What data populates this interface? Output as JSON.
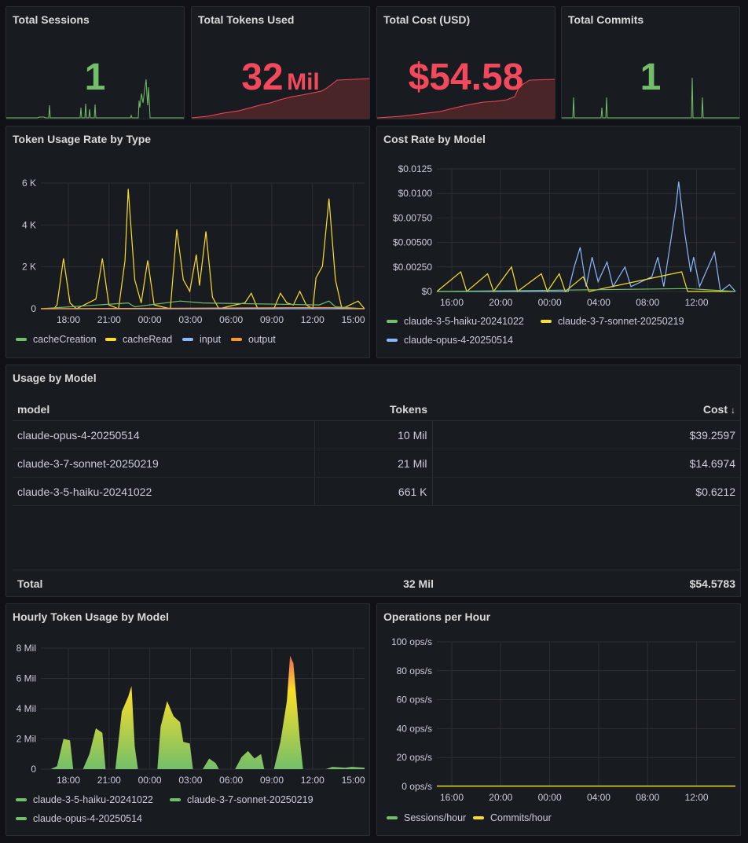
{
  "stats": {
    "sessions": {
      "title": "Total Sessions",
      "value": "1",
      "color": "#73bf69"
    },
    "tokens": {
      "title": "Total Tokens Used",
      "value": "32",
      "unit": "Mil",
      "color": "#f2495c"
    },
    "cost": {
      "title": "Total Cost (USD)",
      "value": "$54.58",
      "color": "#f2495c"
    },
    "commits": {
      "title": "Total Commits",
      "value": "1",
      "color": "#73bf69"
    }
  },
  "token_rate": {
    "title": "Token Usage Rate by Type",
    "legend": [
      {
        "name": "cacheCreation",
        "color": "#73bf69"
      },
      {
        "name": "cacheRead",
        "color": "#fade2a"
      },
      {
        "name": "input",
        "color": "#8ab8ff"
      },
      {
        "name": "output",
        "color": "#ff9830"
      }
    ]
  },
  "cost_rate": {
    "title": "Cost Rate by Model",
    "legend": [
      {
        "name": "claude-3-5-haiku-20241022",
        "color": "#73bf69"
      },
      {
        "name": "claude-3-7-sonnet-20250219",
        "color": "#fade2a"
      },
      {
        "name": "claude-opus-4-20250514",
        "color": "#8ab8ff"
      }
    ]
  },
  "usage_table": {
    "title": "Usage by Model",
    "columns": {
      "model": "model",
      "tokens": "Tokens",
      "cost": "Cost"
    },
    "sort_icon": "arrow-down-icon",
    "rows": [
      {
        "model": "claude-opus-4-20250514",
        "tokens": "10 Mil",
        "cost": "$39.2597"
      },
      {
        "model": "claude-3-7-sonnet-20250219",
        "tokens": "21 Mil",
        "cost": "$14.6974"
      },
      {
        "model": "claude-3-5-haiku-20241022",
        "tokens": "661 K",
        "cost": "$0.6212"
      }
    ],
    "total": {
      "label": "Total",
      "tokens": "32 Mil",
      "cost": "$54.5783"
    }
  },
  "hourly": {
    "title": "Hourly Token Usage by Model",
    "legend": [
      {
        "name": "claude-3-5-haiku-20241022",
        "color": "#73bf69"
      },
      {
        "name": "claude-3-7-sonnet-20250219",
        "color": "#73bf69"
      },
      {
        "name": "claude-opus-4-20250514",
        "color": "#73bf69"
      }
    ]
  },
  "ops": {
    "title": "Operations per Hour",
    "legend": [
      {
        "name": "Sessions/hour",
        "color": "#73bf69"
      },
      {
        "name": "Commits/hour",
        "color": "#fade2a"
      }
    ]
  },
  "chart_data": [
    {
      "type": "line",
      "title": "Token Usage Rate by Type",
      "x_ticks": [
        "18:00",
        "21:00",
        "00:00",
        "03:00",
        "06:00",
        "09:00",
        "12:00",
        "15:00"
      ],
      "y_ticks": [
        "0",
        "2 K",
        "4 K",
        "6 K"
      ],
      "ylim": [
        0,
        6500
      ],
      "series": [
        {
          "name": "cacheRead",
          "points": [
            [
              0.04,
              0
            ],
            [
              0.05,
              200
            ],
            [
              0.07,
              2600
            ],
            [
              0.09,
              300
            ],
            [
              0.11,
              0
            ],
            [
              0.17,
              500
            ],
            [
              0.19,
              2600
            ],
            [
              0.21,
              200
            ],
            [
              0.24,
              0
            ],
            [
              0.26,
              2500
            ],
            [
              0.27,
              6200
            ],
            [
              0.29,
              1500
            ],
            [
              0.31,
              300
            ],
            [
              0.33,
              2500
            ],
            [
              0.35,
              200
            ],
            [
              0.4,
              0
            ],
            [
              0.42,
              4100
            ],
            [
              0.44,
              1500
            ],
            [
              0.46,
              900
            ],
            [
              0.48,
              2800
            ],
            [
              0.49,
              1200
            ],
            [
              0.51,
              4000
            ],
            [
              0.53,
              600
            ],
            [
              0.55,
              0
            ],
            [
              0.6,
              200
            ],
            [
              0.63,
              300
            ],
            [
              0.65,
              800
            ],
            [
              0.67,
              0
            ],
            [
              0.72,
              0
            ],
            [
              0.74,
              800
            ],
            [
              0.76,
              300
            ],
            [
              0.78,
              200
            ],
            [
              0.8,
              900
            ],
            [
              0.82,
              200
            ],
            [
              0.84,
              0
            ],
            [
              0.85,
              1600
            ],
            [
              0.87,
              2200
            ],
            [
              0.89,
              5700
            ],
            [
              0.91,
              1500
            ],
            [
              0.93,
              0
            ],
            [
              0.98,
              400
            ],
            [
              1.0,
              0
            ]
          ],
          "color": "#fade2a"
        },
        {
          "name": "cacheCreation",
          "points": [
            [
              0.0,
              0
            ],
            [
              0.27,
              300
            ],
            [
              0.29,
              100
            ],
            [
              0.43,
              400
            ],
            [
              0.5,
              300
            ],
            [
              0.86,
              200
            ],
            [
              0.89,
              400
            ],
            [
              0.91,
              100
            ],
            [
              1.0,
              0
            ]
          ],
          "color": "#73bf69"
        },
        {
          "name": "input",
          "points": [
            [
              0.0,
              0
            ],
            [
              1.0,
              0
            ]
          ],
          "color": "#8ab8ff"
        },
        {
          "name": "output",
          "points": [
            [
              0.0,
              0
            ],
            [
              0.89,
              60
            ],
            [
              1.0,
              0
            ]
          ],
          "color": "#ff9830"
        }
      ]
    },
    {
      "type": "line",
      "title": "Cost Rate by Model",
      "x_ticks": [
        "16:00",
        "20:00",
        "00:00",
        "04:00",
        "08:00",
        "12:00"
      ],
      "y_ticks": [
        "$0",
        "$0.00250",
        "$0.00500",
        "$0.00750",
        "$0.0100",
        "$0.0125"
      ],
      "ylim": [
        0,
        0.0125
      ],
      "series": [
        {
          "name": "claude-opus-4-20250514",
          "points": [
            [
              0.0,
              0
            ],
            [
              0.44,
              0
            ],
            [
              0.46,
              0.0025
            ],
            [
              0.48,
              0.0045
            ],
            [
              0.5,
              0.0005
            ],
            [
              0.52,
              0.0035
            ],
            [
              0.54,
              0.001
            ],
            [
              0.57,
              0.003
            ],
            [
              0.59,
              0.0005
            ],
            [
              0.63,
              0.0025
            ],
            [
              0.65,
              0.0005
            ],
            [
              0.72,
              0.0015
            ],
            [
              0.74,
              0.0035
            ],
            [
              0.76,
              0.0005
            ],
            [
              0.78,
              0.0045
            ],
            [
              0.8,
              0.0085
            ],
            [
              0.81,
              0.0112
            ],
            [
              0.83,
              0.006
            ],
            [
              0.85,
              0.002
            ],
            [
              0.86,
              0.0035
            ],
            [
              0.88,
              0.0005
            ],
            [
              0.93,
              0.004
            ],
            [
              0.95,
              0.0
            ],
            [
              0.98,
              0.0007
            ],
            [
              1.0,
              0
            ]
          ],
          "color": "#8ab8ff"
        },
        {
          "name": "claude-3-7-sonnet-20250219",
          "points": [
            [
              0.0,
              0
            ],
            [
              0.08,
              0.002
            ],
            [
              0.1,
              0
            ],
            [
              0.17,
              0.0018
            ],
            [
              0.19,
              0
            ],
            [
              0.25,
              0.0025
            ],
            [
              0.27,
              0
            ],
            [
              0.35,
              0.0018
            ],
            [
              0.37,
              0
            ],
            [
              0.41,
              0.0018
            ],
            [
              0.43,
              0
            ],
            [
              0.49,
              0.0015
            ],
            [
              0.51,
              0
            ],
            [
              0.82,
              0.002
            ],
            [
              0.84,
              0
            ],
            [
              1.0,
              0
            ]
          ],
          "color": "#fade2a"
        },
        {
          "name": "claude-3-5-haiku-20241022",
          "points": [
            [
              0.0,
              0
            ],
            [
              0.3,
              0.0001
            ],
            [
              0.84,
              0.0003
            ],
            [
              1.0,
              0
            ]
          ],
          "color": "#73bf69"
        }
      ]
    },
    {
      "type": "area",
      "title": "Hourly Token Usage by Model",
      "x_ticks": [
        "18:00",
        "21:00",
        "00:00",
        "03:00",
        "06:00",
        "09:00",
        "12:00",
        "15:00"
      ],
      "y_ticks": [
        "0",
        "2 Mil",
        "4 Mil",
        "6 Mil",
        "8 Mil"
      ],
      "ylim": [
        0,
        8000000
      ],
      "values": [
        [
          0.0,
          0
        ],
        [
          0.03,
          0
        ],
        [
          0.05,
          200000
        ],
        [
          0.07,
          2000000
        ],
        [
          0.09,
          1900000
        ],
        [
          0.1,
          0
        ],
        [
          0.13,
          0
        ],
        [
          0.15,
          1000000
        ],
        [
          0.17,
          2700000
        ],
        [
          0.19,
          2400000
        ],
        [
          0.2,
          0
        ],
        [
          0.23,
          0
        ],
        [
          0.25,
          3800000
        ],
        [
          0.27,
          4800000
        ],
        [
          0.28,
          5500000
        ],
        [
          0.29,
          1500000
        ],
        [
          0.3,
          0
        ],
        [
          0.36,
          0
        ],
        [
          0.37,
          2800000
        ],
        [
          0.39,
          4500000
        ],
        [
          0.41,
          3500000
        ],
        [
          0.43,
          3100000
        ],
        [
          0.44,
          1800000
        ],
        [
          0.46,
          1700000
        ],
        [
          0.47,
          0
        ],
        [
          0.5,
          0
        ],
        [
          0.52,
          700000
        ],
        [
          0.54,
          400000
        ],
        [
          0.55,
          0
        ],
        [
          0.6,
          0
        ],
        [
          0.62,
          800000
        ],
        [
          0.64,
          1200000
        ],
        [
          0.66,
          700000
        ],
        [
          0.68,
          1000000
        ],
        [
          0.69,
          0
        ],
        [
          0.72,
          0
        ],
        [
          0.74,
          1800000
        ],
        [
          0.76,
          4500000
        ],
        [
          0.77,
          7500000
        ],
        [
          0.78,
          7000000
        ],
        [
          0.8,
          2000000
        ],
        [
          0.81,
          0
        ],
        [
          0.88,
          0
        ],
        [
          0.9,
          150000
        ],
        [
          0.94,
          100000
        ],
        [
          0.96,
          150000
        ],
        [
          1.0,
          100000
        ]
      ]
    },
    {
      "type": "line",
      "title": "Operations per Hour",
      "x_ticks": [
        "16:00",
        "20:00",
        "00:00",
        "04:00",
        "08:00",
        "12:00"
      ],
      "y_ticks": [
        "0 ops/s",
        "20 ops/s",
        "40 ops/s",
        "60 ops/s",
        "80 ops/s",
        "100 ops/s"
      ],
      "ylim": [
        0,
        100
      ],
      "series": [
        {
          "name": "Sessions/hour",
          "points": [
            [
              0.0,
              0.3
            ],
            [
              1.0,
              0.3
            ]
          ],
          "color": "#73bf69"
        },
        {
          "name": "Commits/hour",
          "points": [
            [
              0.0,
              0.2
            ],
            [
              1.0,
              0.2
            ]
          ],
          "color": "#fade2a"
        }
      ]
    }
  ]
}
